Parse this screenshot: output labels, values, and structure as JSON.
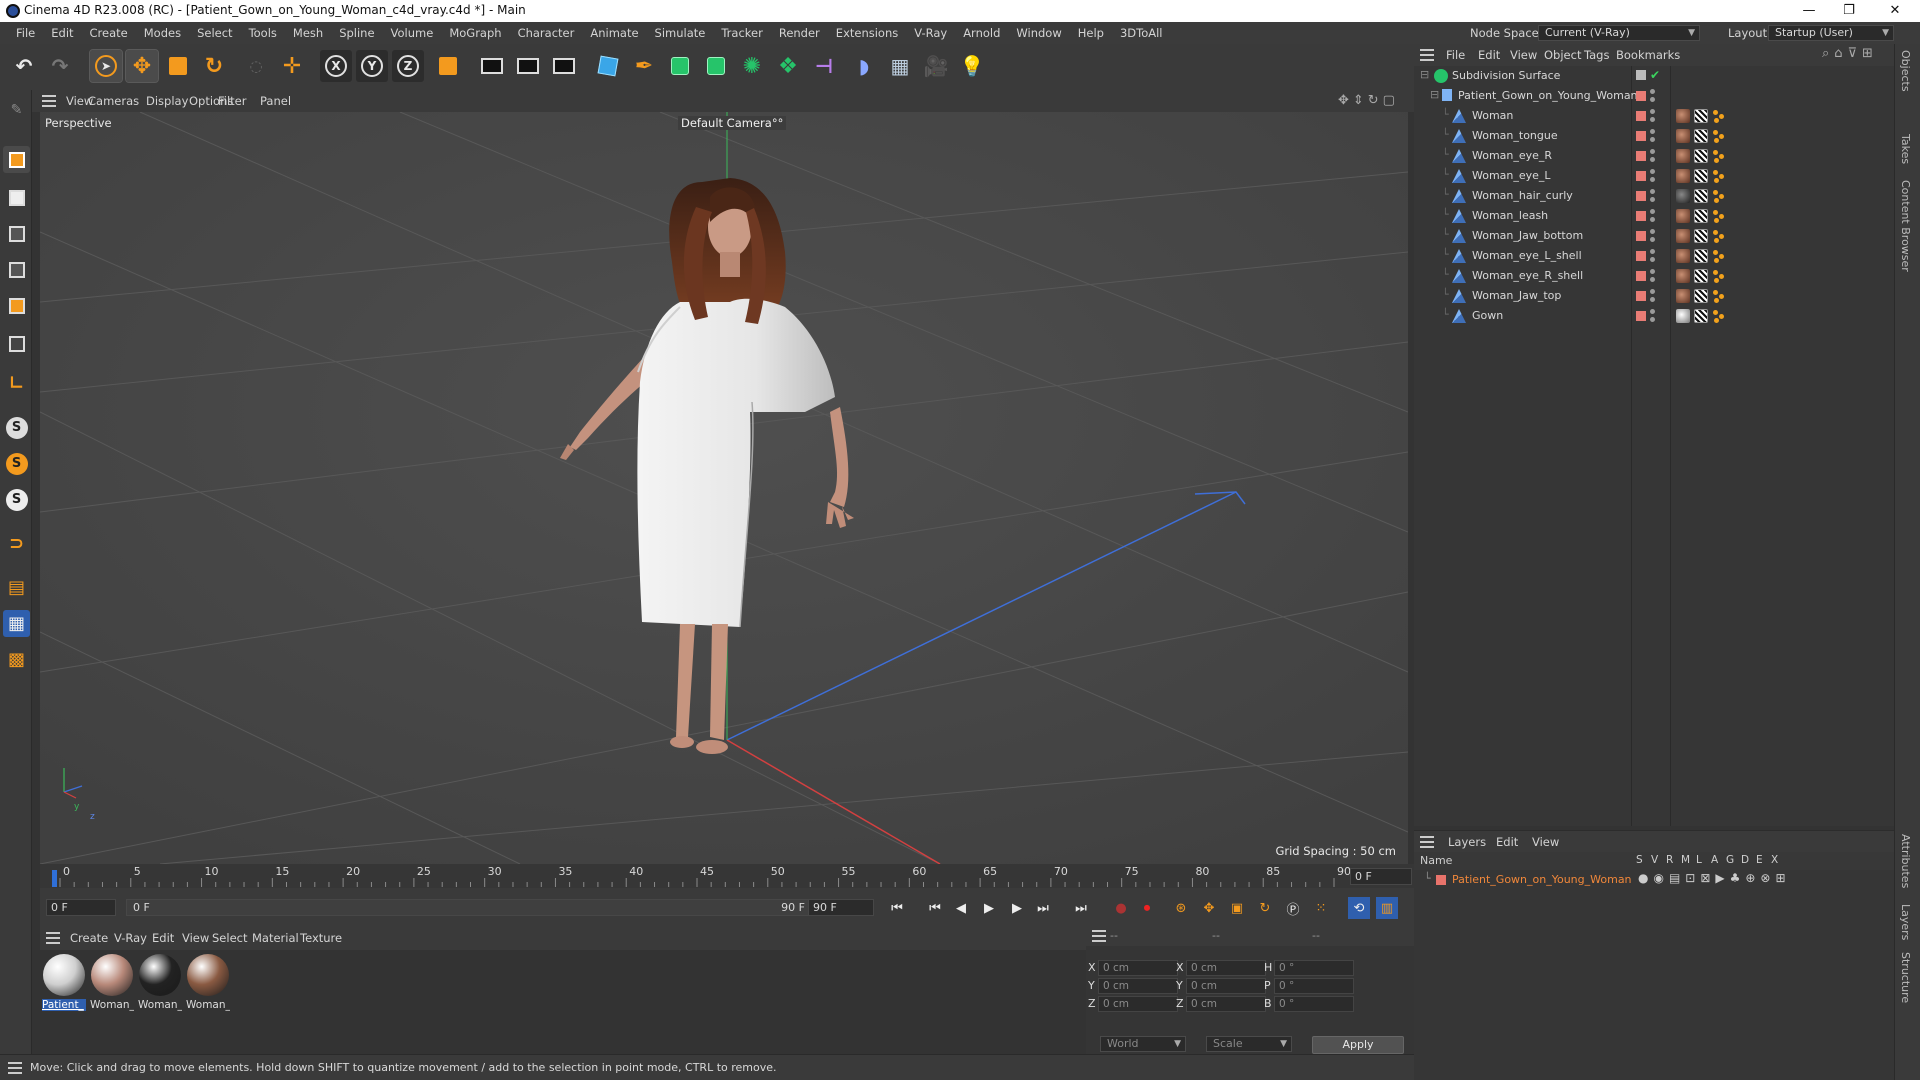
{
  "window": {
    "title": "Cinema 4D R23.008 (RC) - [Patient_Gown_on_Young_Woman_c4d_vray.c4d *] - Main",
    "minimize": "—",
    "maximize": "❐",
    "close": "✕"
  },
  "menubar": {
    "items": [
      "File",
      "Edit",
      "Create",
      "Modes",
      "Select",
      "Tools",
      "Mesh",
      "Spline",
      "Volume",
      "MoGraph",
      "Character",
      "Animate",
      "Simulate",
      "Tracker",
      "Render",
      "Extensions",
      "V-Ray",
      "Arnold",
      "Window",
      "Help",
      "3DToAll"
    ],
    "node_space_label": "Node Space:",
    "node_space_value": "Current (V-Ray)",
    "layout_label": "Layout:",
    "layout_value": "Startup (User)"
  },
  "toolbar": {
    "x_label": "X",
    "y_label": "Y",
    "z_label": "Z"
  },
  "viewport": {
    "menu": [
      "View",
      "Cameras",
      "Display",
      "Options",
      "Filter",
      "Panel"
    ],
    "view_name": "Perspective",
    "camera_name": "Default Camera",
    "camera_suffix": "°°",
    "grid_spacing": "Grid Spacing : 50 cm",
    "axis_y": "y",
    "axis_z": "z"
  },
  "timeline": {
    "ticks": [
      "0",
      "5",
      "10",
      "15",
      "20",
      "25",
      "30",
      "35",
      "40",
      "45",
      "50",
      "55",
      "60",
      "65",
      "70",
      "75",
      "80",
      "85",
      "90"
    ],
    "current_frame_right": "0 F",
    "start_field": "0 F",
    "range_start": "0 F",
    "range_end": "90 F",
    "end_field": "90 F"
  },
  "material_manager": {
    "menu": [
      "Create",
      "V-Ray",
      "Edit",
      "View",
      "Select",
      "Material",
      "Texture"
    ],
    "materials": [
      {
        "name": "Patient_Gown",
        "label": "Patient_",
        "color": "#cfcfcf",
        "selected": true
      },
      {
        "name": "Woman_skin",
        "label": "Woman_",
        "color": "#b8897a",
        "selected": false
      },
      {
        "name": "Woman_eye",
        "label": "Woman_",
        "color": "#222222",
        "selected": false
      },
      {
        "name": "Woman_hair",
        "label": "Woman_",
        "color": "#8a5a42",
        "selected": false
      }
    ]
  },
  "coordinates": {
    "header": [
      "--",
      "--",
      "--"
    ],
    "rows": [
      {
        "l1": "X",
        "v1": "0 cm",
        "l2": "X",
        "v2": "0 cm",
        "l3": "H",
        "v3": "0 °"
      },
      {
        "l1": "Y",
        "v1": "0 cm",
        "l2": "Y",
        "v2": "0 cm",
        "l3": "P",
        "v3": "0 °"
      },
      {
        "l1": "Z",
        "v1": "0 cm",
        "l2": "Z",
        "v2": "0 cm",
        "l3": "B",
        "v3": "0 °"
      }
    ],
    "space_select": "World",
    "mode_select": "Scale",
    "apply_label": "Apply"
  },
  "status": {
    "text": "Move: Click and drag to move elements. Hold down SHIFT to quantize movement / add to the selection in point mode, CTRL to remove."
  },
  "object_manager": {
    "menu": [
      "File",
      "Edit",
      "View",
      "Object",
      "Tags",
      "Bookmarks"
    ],
    "root": "Subdivision Surface",
    "group": "Patient_Gown_on_Young_Woman",
    "objects": [
      "Woman",
      "Woman_tongue",
      "Woman_eye_R",
      "Woman_eye_L",
      "Woman_hair_curly",
      "Woman_leash",
      "Woman_Jaw_bottom",
      "Woman_eye_L_shell",
      "Woman_eye_R_shell",
      "Woman_Jaw_top",
      "Gown"
    ]
  },
  "layers": {
    "menu": [
      "Layers",
      "Edit",
      "View"
    ],
    "col_name": "Name",
    "cols": [
      "S",
      "V",
      "R",
      "M",
      "L",
      "A",
      "G",
      "D",
      "E",
      "X"
    ],
    "layer_name": "Patient_Gown_on_Young_Woman",
    "layer_color": "#e8736b"
  },
  "side_tabs": [
    "Objects",
    "Takes",
    "Content Browser",
    "Attributes",
    "Layers",
    "Structure"
  ],
  "colors": {
    "accent_orange": "#f39a1e",
    "selection_blue": "#2f5fae",
    "layer_text": "#f0873a"
  }
}
